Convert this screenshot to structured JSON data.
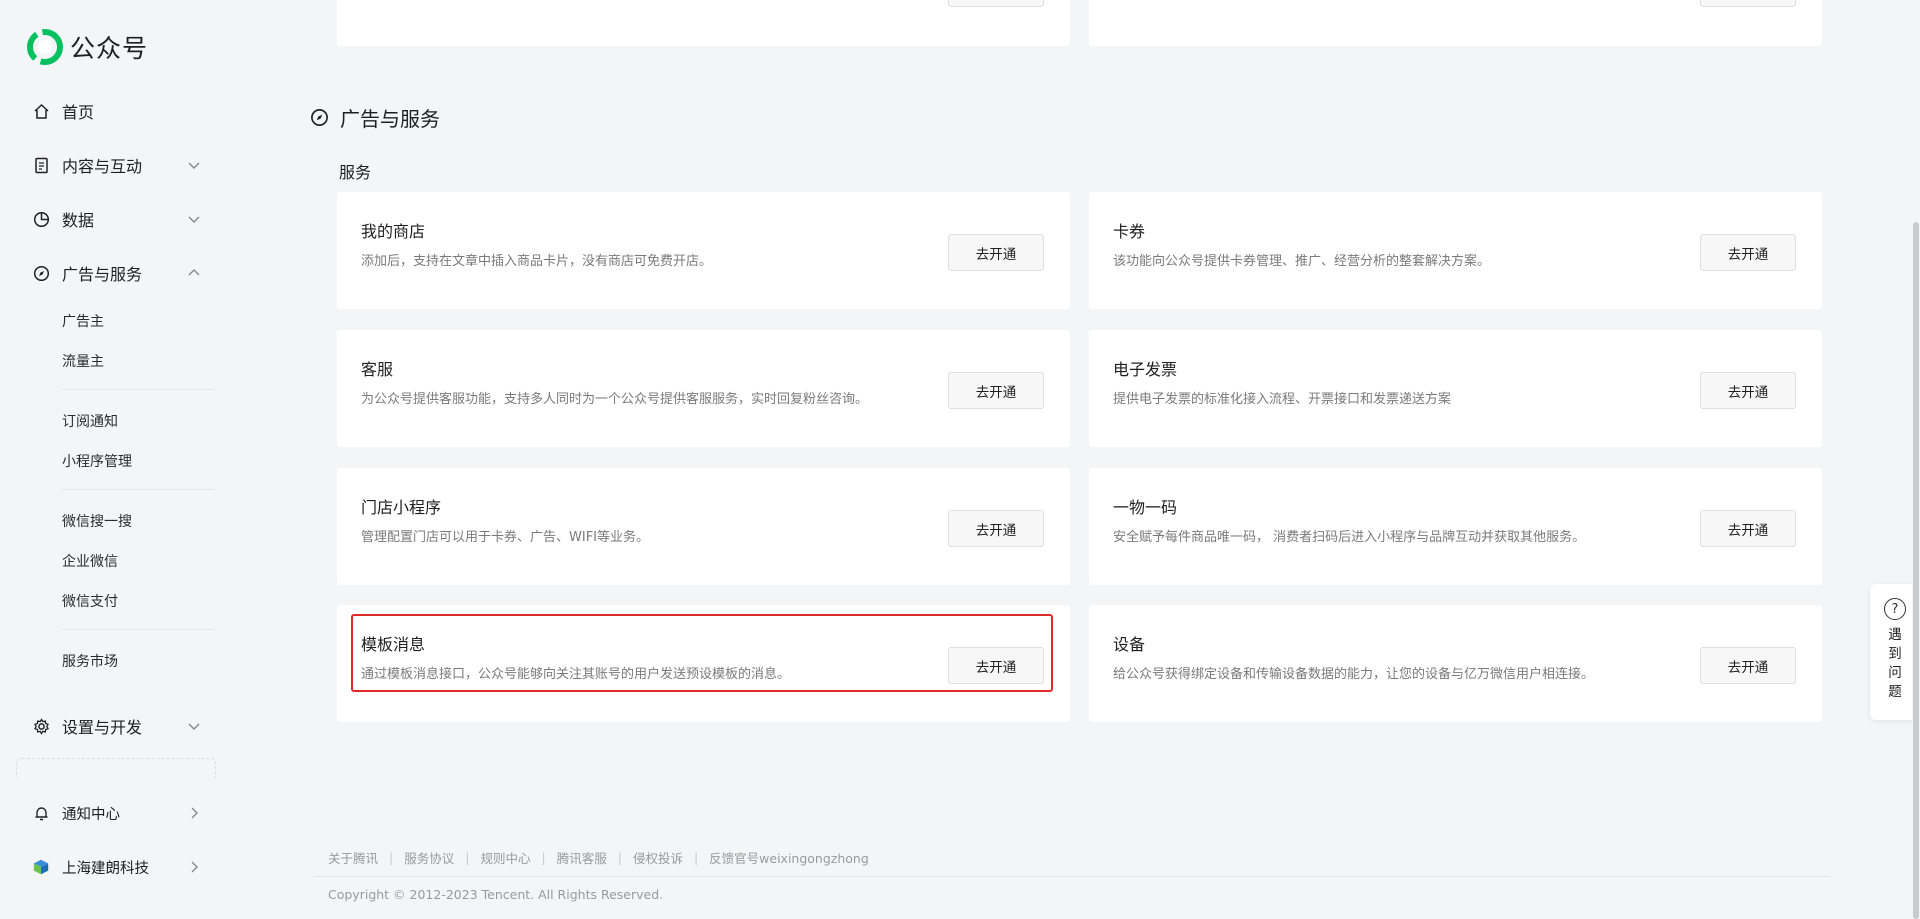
{
  "app": {
    "name": "公众号"
  },
  "sidebar": {
    "home": "首页",
    "content": "内容与互动",
    "data": "数据",
    "ads": "广告与服务",
    "ads_sub": [
      "广告主",
      "流量主",
      "订阅通知",
      "小程序管理",
      "微信搜一搜",
      "企业微信",
      "微信支付",
      "服务市场"
    ],
    "settings": "设置与开发",
    "notifications": "通知中心",
    "account": "上海建朗科技"
  },
  "section": {
    "title": "广告与服务",
    "group": "服务"
  },
  "services": [
    {
      "title": "我的商店",
      "desc": "添加后，支持在文章中插入商品卡片，没有商店可免费开店。",
      "button": "去开通"
    },
    {
      "title": "卡券",
      "desc": "该功能向公众号提供卡券管理、推广、经营分析的整套解决方案。",
      "button": "去开通"
    },
    {
      "title": "客服",
      "desc": "为公众号提供客服功能，支持多人同时为一个公众号提供客服服务，实时回复粉丝咨询。",
      "button": "去开通"
    },
    {
      "title": "电子发票",
      "desc": "提供电子发票的标准化接入流程、开票接口和发票递送方案",
      "button": "去开通"
    },
    {
      "title": "门店小程序",
      "desc": "管理配置门店可以用于卡券、广告、WIFI等业务。",
      "button": "去开通"
    },
    {
      "title": "一物一码",
      "desc": "安全赋予每件商品唯一码， 消费者扫码后进入小程序与品牌互动并获取其他服务。",
      "button": "去开通"
    },
    {
      "title": "模板消息",
      "desc": "通过模板消息接口，公众号能够向关注其账号的用户发送预设模板的消息。",
      "button": "去开通"
    },
    {
      "title": "设备",
      "desc": "给公众号获得绑定设备和传输设备数据的能力，让您的设备与亿万微信用户相连接。",
      "button": "去开通"
    }
  ],
  "footer": {
    "links": [
      "关于腾讯",
      "服务协议",
      "规则中心",
      "腾讯客服",
      "侵权投诉",
      "反馈官号weixingongzhong"
    ],
    "copyright": "Copyright © 2012-2023 Tencent. All Rights Reserved."
  },
  "help": {
    "label": "遇到问题"
  },
  "colors": {
    "highlight": "#e02a2a",
    "brand_green": "#07c160"
  },
  "icons": [
    "home-icon",
    "document-icon",
    "pie-chart-icon",
    "compass-icon",
    "gear-icon",
    "bell-icon",
    "chevron-down-icon",
    "chevron-up-icon",
    "chevron-right-icon",
    "question-icon"
  ]
}
